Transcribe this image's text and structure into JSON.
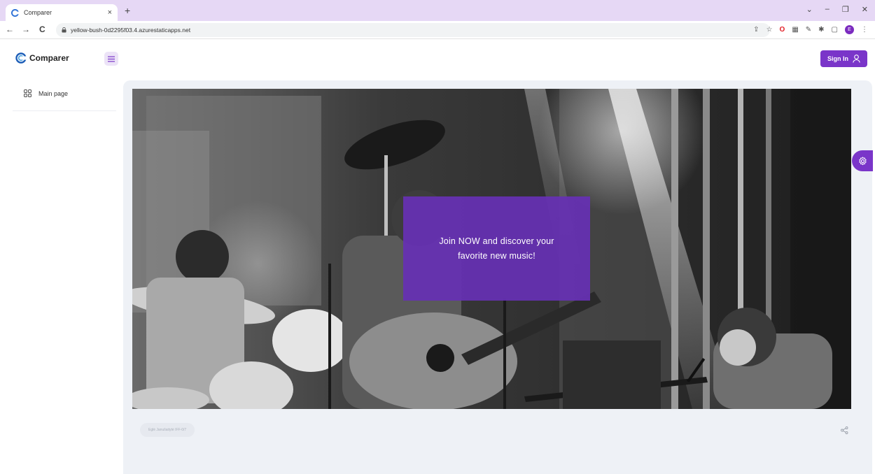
{
  "browser": {
    "tab_title": "Comparer",
    "tab_close": "×",
    "new_tab": "+",
    "url": "yellow-bush-0d2295f03.4.azurestaticapps.net",
    "nav_back": "←",
    "nav_forward": "→",
    "nav_reload": "C",
    "win_controls": [
      "⌄",
      "–",
      "❐",
      "✕"
    ],
    "profile_initial": "E"
  },
  "header": {
    "logo_text": "Comparer",
    "signin_label": "Sign In"
  },
  "sidebar": {
    "items": [
      {
        "label": "Main page",
        "icon": "grid-icon"
      }
    ]
  },
  "hero": {
    "promo_text": "Join NOW and discover your favorite new music!",
    "credit": "Eglė Janušaitytė IFF-0/7"
  },
  "colors": {
    "accent": "#7a35c9",
    "promo": "#6630b4",
    "main_bg": "#eef1f6",
    "tab_strip": "#e6d8f5"
  }
}
